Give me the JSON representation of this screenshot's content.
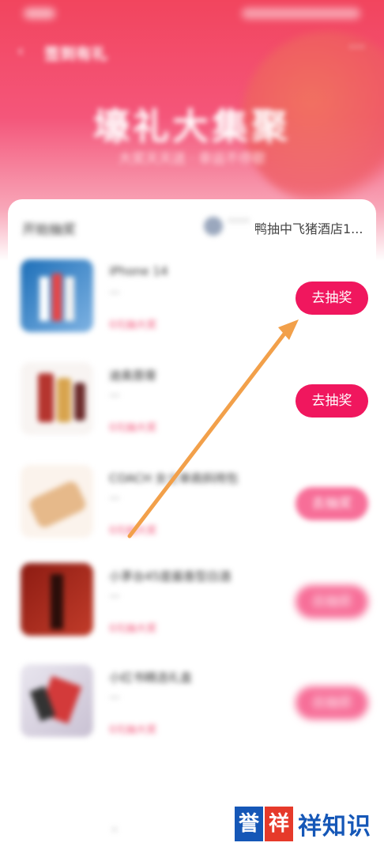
{
  "topbar": {
    "title": "签到有礼",
    "back_icon": "‹",
    "more_icon": "···"
  },
  "hero": {
    "title": "壕礼大集聚",
    "subtitle": "大奖天天送 · 幸运不停歇"
  },
  "card": {
    "title": "开始抽奖",
    "ticker_dots": "****",
    "ticker_text": "鸭抽中飞猪酒店1..."
  },
  "items": [
    {
      "name": "iPhone 14",
      "sub": "—",
      "tag": "0元抽大奖",
      "button": "去抽奖"
    },
    {
      "name": "迪奥唇膏",
      "sub": "—",
      "tag": "0元抽大奖",
      "button": "去抽奖"
    },
    {
      "name": "COACH 女士单肩斜挎包",
      "sub": "—",
      "tag": "0元抽大奖",
      "button": "去抽奖"
    },
    {
      "name": "小茅台45度酱香型白酒",
      "sub": "—",
      "tag": "0元抽大奖",
      "button": "去抽奖"
    },
    {
      "name": "小红书精选礼盒",
      "sub": "—",
      "tag": "0元抽大奖",
      "button": "去抽奖"
    }
  ],
  "watermark": {
    "box1": "誉",
    "box2": "祥",
    "text": "祥知识"
  },
  "colors": {
    "accent": "#f0175e",
    "arrow": "#f2a04a",
    "hero": "#f2455e"
  }
}
